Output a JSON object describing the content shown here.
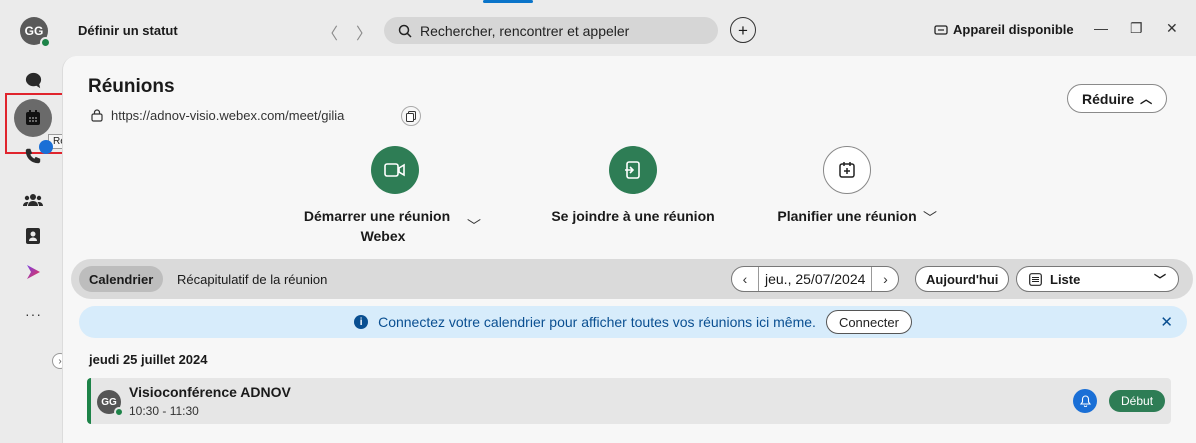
{
  "topbar": {
    "avatar_initials": "GG",
    "status_label": "Définir un statut",
    "back_glyph": "〈",
    "forward_glyph": "〉",
    "search_placeholder": "Rechercher, rencontrer et appeler",
    "device_label": "Appareil disponible",
    "minimize_glyph": "—",
    "maximize_glyph": "❐",
    "close_glyph": "✕"
  },
  "rail": {
    "tooltip": "Réunions",
    "more_glyph": "···",
    "icons": [
      "chat-icon",
      "calendar-icon",
      "phone-icon",
      "people-icon",
      "contacts-icon",
      "apps-icon",
      "more-icon"
    ]
  },
  "main": {
    "title": "Réunions",
    "meeting_url": "https://adnov-visio.webex.com/meet/gilia",
    "reduce_label": "Réduire",
    "actions": {
      "start_line1": "Démarrer une réunion",
      "start_line2": "Webex",
      "join": "Se joindre à une réunion",
      "schedule": "Planifier une réunion"
    },
    "tabs": {
      "calendar": "Calendrier",
      "recap": "Récapitulatif de la réunion"
    },
    "date": "jeu., 25/07/2024",
    "today": "Aujourd'hui",
    "view": "Liste",
    "banner": {
      "text": "Connectez votre calendrier pour afficher toutes vos réunions ici même.",
      "button": "Connecter"
    },
    "day_heading": "jeudi 25 juillet 2024",
    "meeting": {
      "initials": "GG",
      "title": "Visioconférence ADNOV",
      "time": "10:30 - 11:30",
      "start_label": "Début"
    }
  },
  "colors": {
    "accent_green": "#2e7d55",
    "accent_blue": "#1a6fd6",
    "highlight_red": "#e0242d"
  }
}
